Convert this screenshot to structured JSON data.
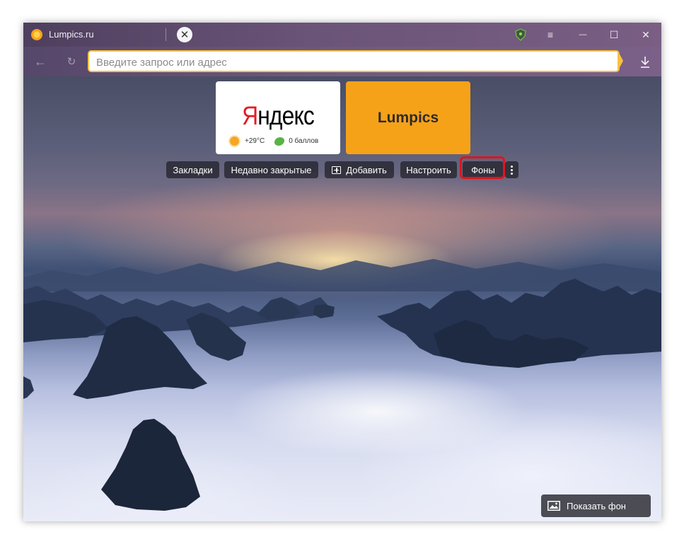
{
  "tab": {
    "title": "Lumpics.ru",
    "new_tab_symbol": "✕"
  },
  "window_controls": {
    "menu_icon": "≡",
    "minimize_icon": "—",
    "maximize_icon": "☐",
    "close_icon": "✕"
  },
  "nav": {
    "back_icon": "←",
    "reload_icon": "↻"
  },
  "omnibox": {
    "placeholder": "Введите запрос или адрес",
    "value": ""
  },
  "tiles": {
    "yandex": {
      "logo_first": "Я",
      "logo_rest": "ндекс",
      "temperature": "+29°C",
      "score": "0 баллов"
    },
    "lumpics": {
      "label": "Lumpics"
    }
  },
  "toolbar": {
    "bookmarks": "Закладки",
    "recently_closed": "Недавно закрытые",
    "add": "Добавить",
    "settings": "Настроить",
    "backgrounds": "Фоны"
  },
  "show_background": {
    "label": "Показать фон"
  },
  "colors": {
    "accent_omnibox": "#f6c142",
    "lumpics_tile": "#f6a219",
    "highlight": "#e1141c",
    "yandex_red": "#e31b23"
  }
}
